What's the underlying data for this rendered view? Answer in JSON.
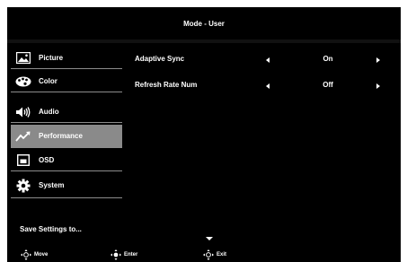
{
  "osd": {
    "title": "Mode - User"
  },
  "sidebar": {
    "items": [
      {
        "label": "Picture",
        "icon": "picture-icon"
      },
      {
        "label": "Color",
        "icon": "color-palette-icon"
      },
      {
        "label": "Audio",
        "icon": "speaker-icon"
      },
      {
        "label": "Performance",
        "icon": "performance-trend-icon",
        "active": true
      },
      {
        "label": "OSD",
        "icon": "osd-window-icon"
      },
      {
        "label": "System",
        "icon": "gear-icon"
      }
    ],
    "save_settings": "Save Settings to..."
  },
  "settings": [
    {
      "label": "Adaptive Sync",
      "value": "On"
    },
    {
      "label": "Refresh Rate Num",
      "value": "Off"
    }
  ],
  "footer": {
    "move": "Move",
    "enter": "Enter",
    "exit": "Exit"
  },
  "colors": {
    "background": "#000000",
    "active_item": "#8a8a8a",
    "divider": "#8c8c8c",
    "text": "#ffffff"
  }
}
